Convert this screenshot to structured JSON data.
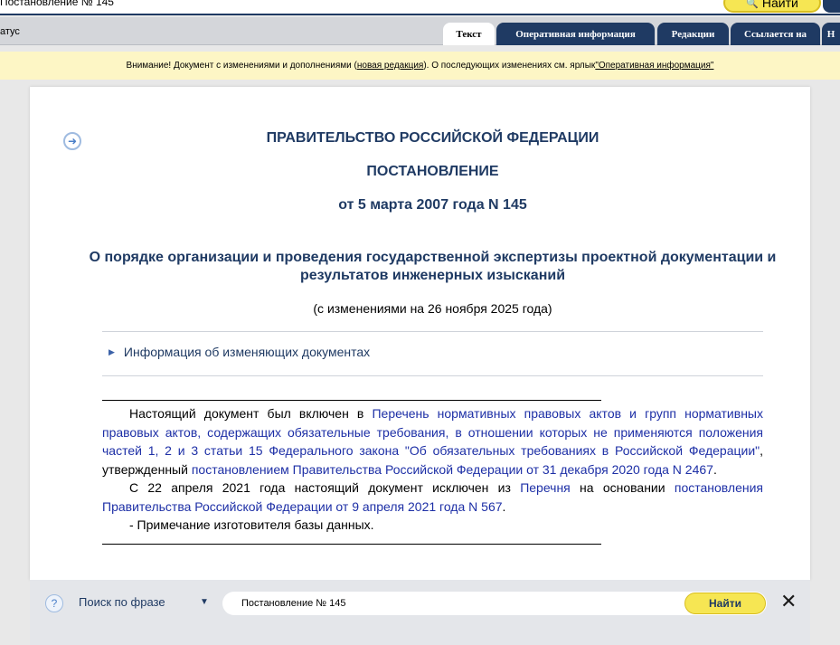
{
  "header": {
    "doc_title": "Постановление № 145",
    "find_label": "Найти",
    "find_icon": "search-icon"
  },
  "tabsrow": {
    "status": "атус",
    "tabs": [
      {
        "label": "Текст",
        "active": true
      },
      {
        "label": "Оперативная информация"
      },
      {
        "label": "Редакции"
      },
      {
        "label": "Ссылается на"
      },
      {
        "label": "Н"
      }
    ]
  },
  "warning": {
    "prefix": "Внимание! Документ с изменениями и дополнениями (",
    "new_edition_link": "новая редакция",
    "middle": "). О последующих изменениях см. ярлык ",
    "op_info_link": "\"Оперативная информация\""
  },
  "document": {
    "government": "ПРАВИТЕЛЬСТВО РОССИЙСКОЙ ФЕДЕРАЦИИ",
    "decree": "ПОСТАНОВЛЕНИЕ",
    "date": "от 5 марта 2007 года N 145",
    "title": "О порядке организации и проведения государственной экспертизы проектной документации и результатов инженерных изысканий",
    "changes": "(с изменениями на 26 ноября 2025 года)",
    "info_link": "Информация об изменяющих документах",
    "note": {
      "p1_a": "Настоящий документ был включен в ",
      "p1_link1": "Перечень нормативных правовых актов и групп нормативных правовых актов, содержащих обязательные требования, в отношении которых не применяются положения частей 1, 2 и 3 статьи 15 Федерального закона \"Об обязательных требованиях в Российской Федерации\"",
      "p1_b": ", утвержденный ",
      "p1_link2": "постановлением Правительства Российской Федерации от 31 декабря 2020 года N 2467",
      "p1_c": ".",
      "p2_a": "С 22 апреля 2021 года настоящий документ исключен из ",
      "p2_link1": "Перечня",
      "p2_b": " на основании ",
      "p2_link2": "постановления Правительства Российской Федерации от 9 апреля 2021 года N 567",
      "p2_c": ".",
      "p3": "- Примечание изготовителя базы данных."
    }
  },
  "search": {
    "help_icon": "?",
    "mode_label": "Поиск по фразе",
    "dropdown_icon": "▼",
    "input_value": "Постановление № 145",
    "button_label": "Найти",
    "close_icon": "✕"
  },
  "colors": {
    "navy": "#1f3a63",
    "link_blue": "#1d2fa6",
    "yellow": "#f6e653",
    "warning_bg": "#fdf6c5"
  }
}
